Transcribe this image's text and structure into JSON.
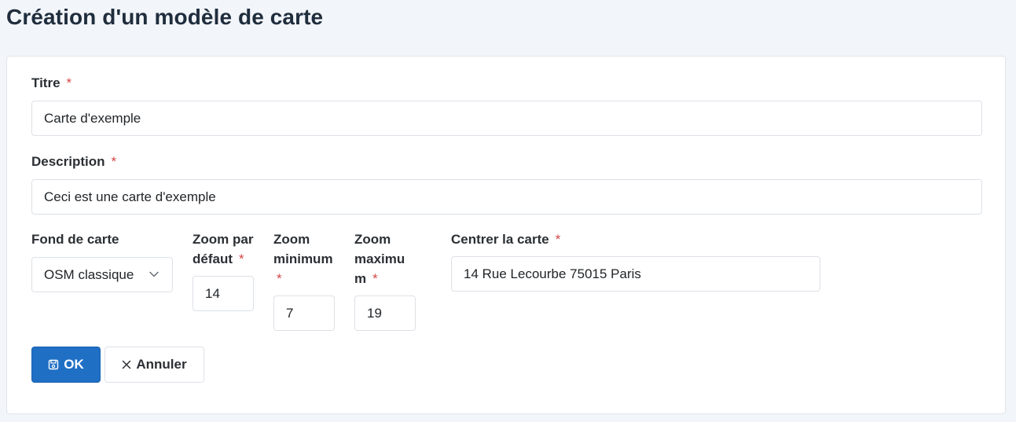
{
  "page": {
    "title": "Création d'un modèle de carte"
  },
  "form": {
    "required_mark": "*",
    "titre": {
      "label": "Titre",
      "value": "Carte d'exemple"
    },
    "description": {
      "label": "Description",
      "value": "Ceci est une carte d'exemple"
    },
    "fond": {
      "label": "Fond de carte",
      "value": "OSM classique"
    },
    "zoom_defaut": {
      "label_line1": "Zoom par",
      "label_line2": "défaut",
      "value": "14"
    },
    "zoom_min": {
      "label_line1": "Zoom",
      "label_line2": "minimum",
      "value": "7"
    },
    "zoom_max": {
      "label_line1": "Zoom",
      "label_line2": "maximu",
      "label_line3": "m",
      "value": "19"
    },
    "centre": {
      "label": "Centrer la carte",
      "value": "14 Rue Lecourbe 75015 Paris"
    }
  },
  "actions": {
    "ok_label": "OK",
    "cancel_label": "Annuler"
  },
  "icons": {
    "ok": "save-icon",
    "cancel": "close-icon",
    "select": "chevron-down-icon"
  }
}
